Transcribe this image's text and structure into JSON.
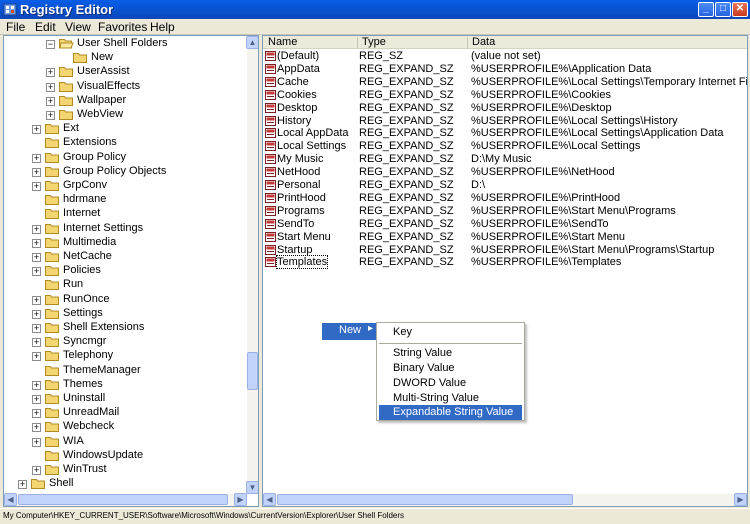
{
  "window": {
    "title": "Registry Editor"
  },
  "titlebar_buttons": {
    "minimize": "_",
    "maximize": "□",
    "close": "✕"
  },
  "menu": [
    "File",
    "Edit",
    "View",
    "Favorites",
    "Help"
  ],
  "tree": [
    {
      "label": "User Shell Folders",
      "level": 2,
      "expander": "−",
      "open": true
    },
    {
      "label": "New",
      "level": 3,
      "expander": "",
      "open": false
    },
    {
      "label": "UserAssist",
      "level": 2,
      "expander": "+",
      "open": false
    },
    {
      "label": "VisualEffects",
      "level": 2,
      "expander": "+",
      "open": false
    },
    {
      "label": "Wallpaper",
      "level": 2,
      "expander": "+",
      "open": false
    },
    {
      "label": "WebView",
      "level": 2,
      "expander": "+",
      "open": false
    },
    {
      "label": "Ext",
      "level": 1,
      "expander": "+",
      "open": false
    },
    {
      "label": "Extensions",
      "level": 1,
      "expander": "",
      "open": false
    },
    {
      "label": "Group Policy",
      "level": 1,
      "expander": "+",
      "open": false
    },
    {
      "label": "Group Policy Objects",
      "level": 1,
      "expander": "+",
      "open": false
    },
    {
      "label": "GrpConv",
      "level": 1,
      "expander": "+",
      "open": false
    },
    {
      "label": "hdrmane",
      "level": 1,
      "expander": "",
      "open": false
    },
    {
      "label": "Internet",
      "level": 1,
      "expander": "",
      "open": false
    },
    {
      "label": "Internet Settings",
      "level": 1,
      "expander": "+",
      "open": false
    },
    {
      "label": "Multimedia",
      "level": 1,
      "expander": "+",
      "open": false
    },
    {
      "label": "NetCache",
      "level": 1,
      "expander": "+",
      "open": false
    },
    {
      "label": "Policies",
      "level": 1,
      "expander": "+",
      "open": false
    },
    {
      "label": "Run",
      "level": 1,
      "expander": "",
      "open": false
    },
    {
      "label": "RunOnce",
      "level": 1,
      "expander": "+",
      "open": false
    },
    {
      "label": "Settings",
      "level": 1,
      "expander": "+",
      "open": false
    },
    {
      "label": "Shell Extensions",
      "level": 1,
      "expander": "+",
      "open": false
    },
    {
      "label": "Syncmgr",
      "level": 1,
      "expander": "+",
      "open": false
    },
    {
      "label": "Telephony",
      "level": 1,
      "expander": "+",
      "open": false
    },
    {
      "label": "ThemeManager",
      "level": 1,
      "expander": "",
      "open": false
    },
    {
      "label": "Themes",
      "level": 1,
      "expander": "+",
      "open": false
    },
    {
      "label": "Uninstall",
      "level": 1,
      "expander": "+",
      "open": false
    },
    {
      "label": "UnreadMail",
      "level": 1,
      "expander": "+",
      "open": false
    },
    {
      "label": "Webcheck",
      "level": 1,
      "expander": "+",
      "open": false
    },
    {
      "label": "WIA",
      "level": 1,
      "expander": "+",
      "open": false
    },
    {
      "label": "WindowsUpdate",
      "level": 1,
      "expander": "",
      "open": false
    },
    {
      "label": "WinTrust",
      "level": 1,
      "expander": "+",
      "open": false
    },
    {
      "label": "Shell",
      "level": 0,
      "expander": "+",
      "open": false
    }
  ],
  "columns": {
    "name": "Name",
    "type": "Type",
    "data": "Data"
  },
  "values": [
    {
      "name": "(Default)",
      "type": "REG_SZ",
      "data": "(value not set)"
    },
    {
      "name": "AppData",
      "type": "REG_EXPAND_SZ",
      "data": "%USERPROFILE%\\Application Data"
    },
    {
      "name": "Cache",
      "type": "REG_EXPAND_SZ",
      "data": "%USERPROFILE%\\Local Settings\\Temporary Internet Files"
    },
    {
      "name": "Cookies",
      "type": "REG_EXPAND_SZ",
      "data": "%USERPROFILE%\\Cookies"
    },
    {
      "name": "Desktop",
      "type": "REG_EXPAND_SZ",
      "data": "%USERPROFILE%\\Desktop"
    },
    {
      "name": "History",
      "type": "REG_EXPAND_SZ",
      "data": "%USERPROFILE%\\Local Settings\\History"
    },
    {
      "name": "Local AppData",
      "type": "REG_EXPAND_SZ",
      "data": "%USERPROFILE%\\Local Settings\\Application Data"
    },
    {
      "name": "Local Settings",
      "type": "REG_EXPAND_SZ",
      "data": "%USERPROFILE%\\Local Settings"
    },
    {
      "name": "My Music",
      "type": "REG_EXPAND_SZ",
      "data": "D:\\My Music"
    },
    {
      "name": "NetHood",
      "type": "REG_EXPAND_SZ",
      "data": "%USERPROFILE%\\NetHood"
    },
    {
      "name": "Personal",
      "type": "REG_EXPAND_SZ",
      "data": "D:\\"
    },
    {
      "name": "PrintHood",
      "type": "REG_EXPAND_SZ",
      "data": "%USERPROFILE%\\PrintHood"
    },
    {
      "name": "Programs",
      "type": "REG_EXPAND_SZ",
      "data": "%USERPROFILE%\\Start Menu\\Programs"
    },
    {
      "name": "SendTo",
      "type": "REG_EXPAND_SZ",
      "data": "%USERPROFILE%\\SendTo"
    },
    {
      "name": "Start Menu",
      "type": "REG_EXPAND_SZ",
      "data": "%USERPROFILE%\\Start Menu"
    },
    {
      "name": "Startup",
      "type": "REG_EXPAND_SZ",
      "data": "%USERPROFILE%\\Start Menu\\Programs\\Startup"
    },
    {
      "name": "Templates",
      "type": "REG_EXPAND_SZ",
      "data": "%USERPROFILE%\\Templates",
      "focused": true
    }
  ],
  "context_menu": {
    "parent_label": "New",
    "parent_arrow": "▸",
    "items": [
      "Key",
      "String Value",
      "Binary Value",
      "DWORD Value",
      "Multi-String Value",
      "Expandable String Value"
    ],
    "highlighted": "Expandable String Value"
  },
  "status": "My Computer\\HKEY_CURRENT_USER\\Software\\Microsoft\\Windows\\CurrentVersion\\Explorer\\User Shell Folders",
  "colors": {
    "highlight": "#316ac5",
    "title_blue": "#0754d6",
    "folder": "#f3d571"
  }
}
